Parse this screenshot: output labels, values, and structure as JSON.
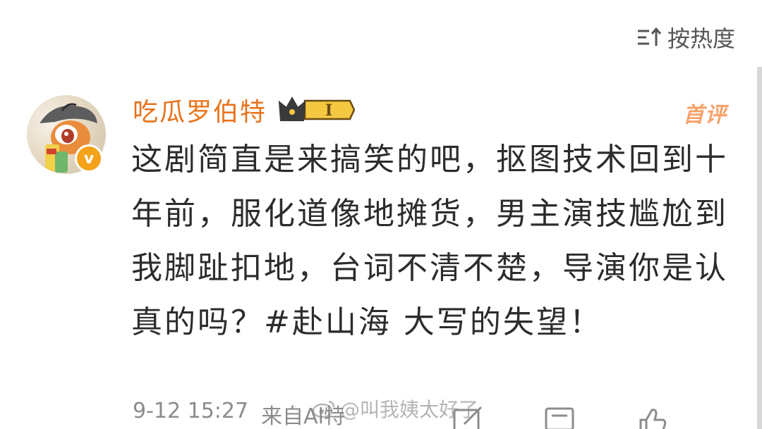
{
  "sort": {
    "label": "按热度",
    "icon": "sort-icon"
  },
  "comment": {
    "username": "吃瓜罗伯特",
    "level_badge": "I",
    "verified_badge": "v",
    "first_comment_tag": "首评",
    "text": "这剧简直是来搞笑的吧，抠图技术回到十年前，服化道像地摊货，男主演技尴尬到我脚趾扣地，台词不清不楚，导演你是认真的吗？#赴山海 大写的失望！",
    "timestamp": "9-12 15:27",
    "source": "来自Al特"
  },
  "actions": {
    "icons": [
      "share-icon",
      "comment-icon",
      "like-icon"
    ]
  },
  "watermark": {
    "text": "@叫我姨太好了"
  },
  "colors": {
    "username": "#e8731b",
    "first_comment_tag": "#f7a26a",
    "verified_badge": "#f4a219",
    "body_text": "#2c2c2c",
    "meta_text": "#8c8c8c"
  }
}
